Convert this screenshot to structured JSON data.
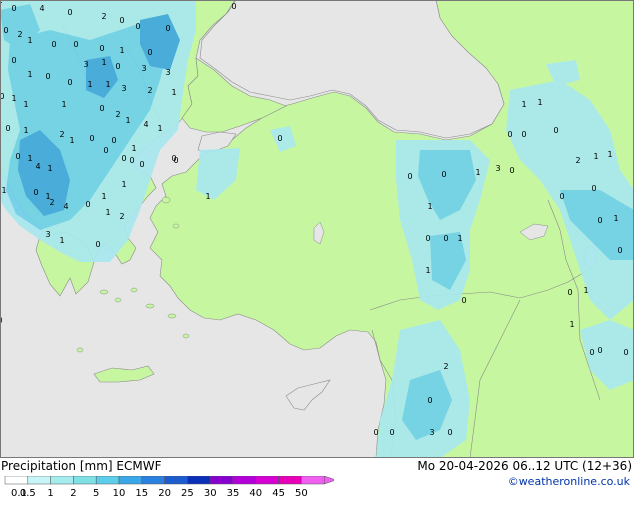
{
  "header": {
    "title": "Precipitation [mm]",
    "model": "ECMWF",
    "datetime": "Mo 20-04-2026 06..12 UTC (12+36)",
    "credit": "©weatheronline.co.uk"
  },
  "legend": {
    "ticks": [
      "0.1",
      "0.5",
      "1",
      "2",
      "5",
      "10",
      "15",
      "20",
      "25",
      "30",
      "35",
      "40",
      "45",
      "50"
    ],
    "colors": [
      "#ffffff",
      "#c8f5f5",
      "#a5ecec",
      "#7fe0e6",
      "#5ccdea",
      "#3aa8e8",
      "#2a80de",
      "#1b5cd0",
      "#0c2fb8",
      "#8a00d0",
      "#b400d8",
      "#d600d6",
      "#e800b8",
      "#f060f0"
    ]
  },
  "map": {
    "colors": {
      "sea": "#e6e6e6",
      "land": "#c6f7a0",
      "border": "#8a8a8a",
      "light_precip": "#a8e8ef",
      "medium_precip": "#6fd0ea",
      "heavy_precip": "#3fa6de"
    },
    "values": [
      {
        "v": "0"
      },
      {
        "v": "4"
      },
      {
        "v": "0"
      },
      {
        "v": "2"
      },
      {
        "v": "0"
      },
      {
        "v": "0"
      },
      {
        "v": "0"
      },
      {
        "v": "0"
      },
      {
        "v": "2"
      },
      {
        "v": "1"
      },
      {
        "v": "0"
      },
      {
        "v": "0"
      },
      {
        "v": "0"
      },
      {
        "v": "1"
      },
      {
        "v": "0"
      },
      {
        "v": "0"
      },
      {
        "v": "3"
      },
      {
        "v": "1"
      },
      {
        "v": "0"
      },
      {
        "v": "3"
      },
      {
        "v": "3"
      },
      {
        "v": "1"
      },
      {
        "v": "0"
      },
      {
        "v": "0"
      },
      {
        "v": "1"
      },
      {
        "v": "1"
      },
      {
        "v": "3"
      },
      {
        "v": "2"
      },
      {
        "v": "1"
      },
      {
        "v": "0"
      },
      {
        "v": "1"
      },
      {
        "v": "1"
      },
      {
        "v": "1"
      },
      {
        "v": "0"
      },
      {
        "v": "2"
      },
      {
        "v": "1"
      },
      {
        "v": "4"
      },
      {
        "v": "1"
      },
      {
        "v": "0"
      },
      {
        "v": "1"
      },
      {
        "v": "2"
      },
      {
        "v": "1"
      },
      {
        "v": "0"
      },
      {
        "v": "0"
      },
      {
        "v": "1"
      },
      {
        "v": "0"
      },
      {
        "v": "0"
      },
      {
        "v": "1"
      },
      {
        "v": "4"
      },
      {
        "v": "1"
      },
      {
        "v": "0"
      },
      {
        "v": "0"
      },
      {
        "v": "0"
      },
      {
        "v": "1"
      },
      {
        "v": "0"
      },
      {
        "v": "1"
      },
      {
        "v": "2"
      },
      {
        "v": "4"
      },
      {
        "v": "0"
      },
      {
        "v": "1"
      },
      {
        "v": "2"
      },
      {
        "v": "3"
      },
      {
        "v": "1"
      },
      {
        "v": "0"
      },
      {
        "v": "1"
      },
      {
        "v": "0"
      },
      {
        "v": "0"
      },
      {
        "v": "0"
      },
      {
        "v": "1"
      },
      {
        "v": "3"
      },
      {
        "v": "0"
      },
      {
        "v": "0"
      },
      {
        "v": "1"
      },
      {
        "v": "1"
      },
      {
        "v": "0"
      },
      {
        "v": "0"
      },
      {
        "v": "2"
      },
      {
        "v": "1"
      },
      {
        "v": "1"
      },
      {
        "v": "1"
      },
      {
        "v": "0"
      },
      {
        "v": "0"
      },
      {
        "v": "1"
      },
      {
        "v": "0"
      },
      {
        "v": "0"
      },
      {
        "v": "0"
      },
      {
        "v": "0"
      },
      {
        "v": "1"
      },
      {
        "v": "0"
      },
      {
        "v": "0"
      },
      {
        "v": "1"
      },
      {
        "v": "1"
      },
      {
        "v": "0"
      },
      {
        "v": "0"
      },
      {
        "v": "0"
      },
      {
        "v": "3"
      },
      {
        "v": "0"
      },
      {
        "v": "0"
      },
      {
        "v": "2"
      },
      {
        "v": "1"
      },
      {
        "v": "0"
      },
      {
        "v": "1"
      },
      {
        "v": "1"
      },
      {
        "v": "0"
      },
      {
        "v": "0"
      },
      {
        "v": "0"
      },
      {
        "v": "0"
      },
      {
        "v": "0"
      },
      {
        "v": "2"
      },
      {
        "v": "1"
      },
      {
        "v": "1"
      }
    ]
  }
}
